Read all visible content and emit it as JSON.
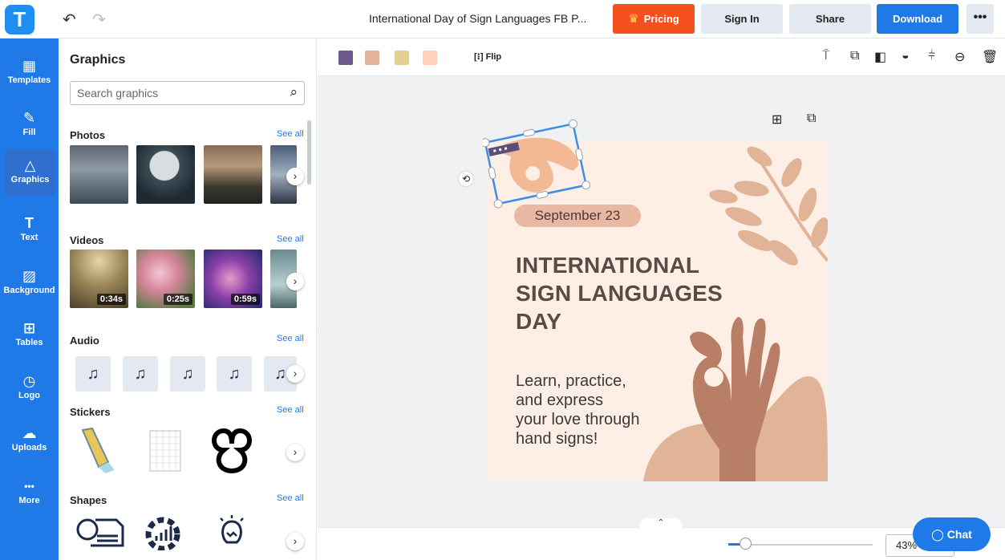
{
  "header": {
    "logo_letter": "T",
    "undo_icon": "↶",
    "redo_icon": "↷",
    "document_title": "International Day of Sign Languages FB P...",
    "pricing_label": "Pricing",
    "sign_in_label": "Sign In",
    "share_label": "Share",
    "download_label": "Download",
    "more_label": "•••"
  },
  "rail": {
    "items": [
      {
        "label": "Templates",
        "icon": "▦"
      },
      {
        "label": "Fill",
        "icon": "✎"
      },
      {
        "label": "Graphics",
        "icon": "△"
      },
      {
        "label": "Text",
        "icon": "T"
      },
      {
        "label": "Background",
        "icon": "▨"
      },
      {
        "label": "Tables",
        "icon": "⊞"
      },
      {
        "label": "Logo",
        "icon": "◷"
      },
      {
        "label": "Uploads",
        "icon": "☁"
      },
      {
        "label": "More",
        "icon": "•••"
      }
    ]
  },
  "panel": {
    "title": "Graphics",
    "search_placeholder": "Search graphics",
    "see_all": "See all",
    "sections": {
      "photos": "Photos",
      "videos": "Videos",
      "audio": "Audio",
      "stickers": "Stickers",
      "shapes": "Shapes"
    },
    "video_durations": [
      "0:34s",
      "0:25s",
      "0:59s"
    ],
    "audio_icon": "♫"
  },
  "toolbar": {
    "swatches": [
      "#6b5a8a",
      "#e2b497",
      "#e3cf92",
      "#fdd2b8"
    ],
    "flip_label": "Flip"
  },
  "artboard": {
    "date": "September 23",
    "headline": [
      "INTERNATIONAL",
      "SIGN LANGUAGES",
      "DAY"
    ],
    "body": [
      "Learn, practice,",
      "and express",
      "your love through",
      "hand signs!"
    ]
  },
  "bottom": {
    "zoom": "43%",
    "chat_label": "Chat"
  }
}
